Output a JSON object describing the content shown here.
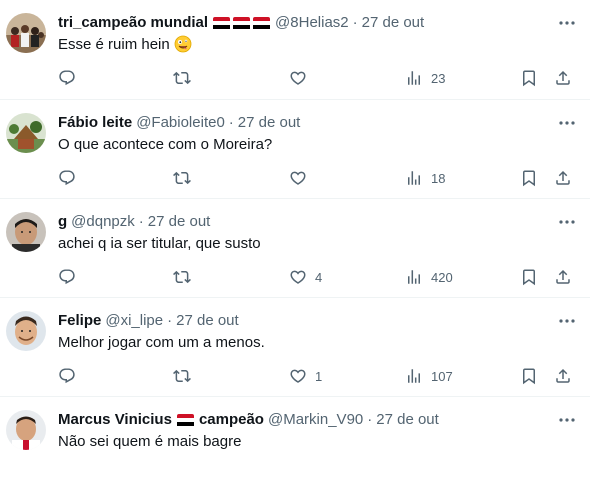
{
  "tweets": [
    {
      "name": "tri_campeão mundial",
      "flags": 3,
      "handle": "@8Helias2",
      "separator": "·",
      "date": "27 de out",
      "text": "Esse é ruim hein",
      "emoji": "zany-face",
      "replies": "",
      "retweets": "",
      "likes": "",
      "views": "23"
    },
    {
      "name": "Fábio leite",
      "flags": 0,
      "handle": "@Fabioleite0",
      "separator": "·",
      "date": "27 de out",
      "text": "O que acontece com o Moreira?",
      "replies": "",
      "retweets": "",
      "likes": "",
      "views": "18"
    },
    {
      "name": "g",
      "flags": 0,
      "handle": "@dqnpzk",
      "separator": "·",
      "date": "27 de out",
      "text": "achei q ia ser titular, que susto",
      "replies": "",
      "retweets": "",
      "likes": "4",
      "views": "420"
    },
    {
      "name": "Felipe",
      "flags": 0,
      "handle": "@xi_lipe",
      "separator": "·",
      "date": "27 de out",
      "text": "Melhor jogar com um a menos.",
      "replies": "",
      "retweets": "",
      "likes": "1",
      "views": "107"
    },
    {
      "name": "Marcus Vinicius",
      "name_suffix": "campeão",
      "flags": 1,
      "handle": "@Markin_V90",
      "separator": "·",
      "date": "27 de out",
      "text": "Não sei quem é mais bagre"
    }
  ],
  "icons": {
    "reply": "reply-icon",
    "retweet": "retweet-icon",
    "like": "heart-icon",
    "views": "views-chart-icon",
    "bookmark": "bookmark-icon",
    "share": "share-icon",
    "more": "more-dots-icon",
    "flag": "flag-red-white-black-icon"
  },
  "colors": {
    "text": "#0f1419",
    "secondary": "#536471",
    "divider": "#eff3f4",
    "flag_red": "#ce1126",
    "flag_white": "#ffffff",
    "flag_black": "#000000"
  }
}
